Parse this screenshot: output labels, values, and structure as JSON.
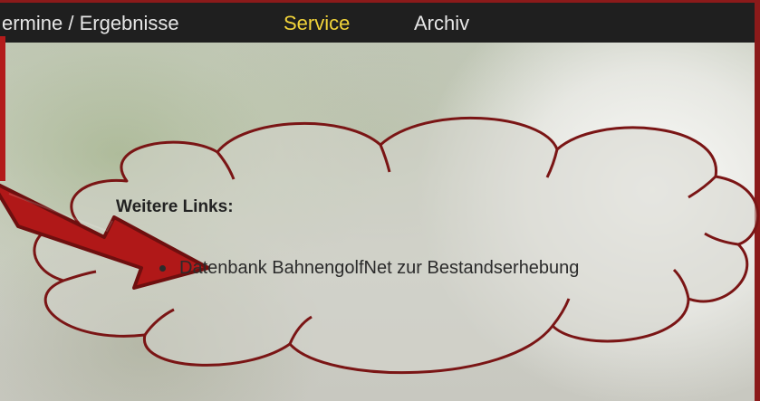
{
  "nav": {
    "items": [
      {
        "label": "ermine / Ergebnisse",
        "active": false
      },
      {
        "label": "Service",
        "active": true
      },
      {
        "label": "Archiv",
        "active": false
      }
    ]
  },
  "content": {
    "heading": "Weitere Links:",
    "links": [
      {
        "label": "Datenbank BahnengolfNet zur Bestandserhebung"
      }
    ]
  },
  "annotation": {
    "arrow_icon": "arrow-icon",
    "cloud_icon": "cloud-callout",
    "color": "#8b1a1a"
  },
  "colors": {
    "nav_bg": "#1f1f1f",
    "nav_text": "#e6e6e6",
    "nav_active": "#f2d43a",
    "accent_red": "#b31b1b"
  }
}
